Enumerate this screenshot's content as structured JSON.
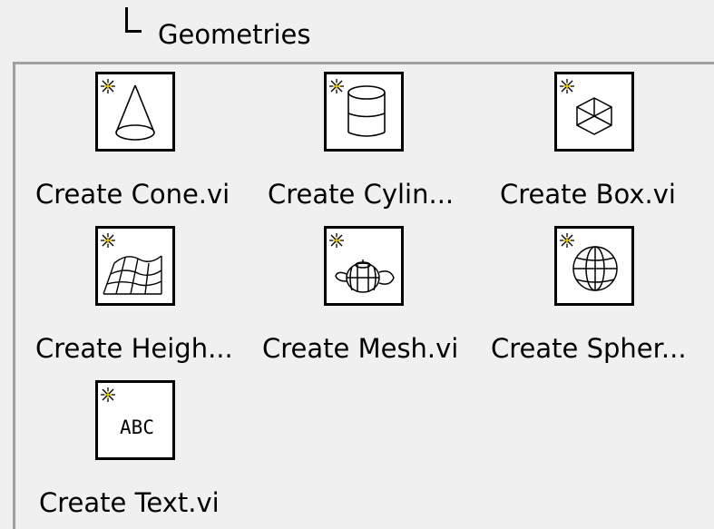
{
  "section": {
    "title": "Geometries"
  },
  "palette": {
    "items": [
      {
        "label": "Create Cone.vi",
        "icon": "cone-icon"
      },
      {
        "label": "Create Cylin...",
        "icon": "cylinder-icon"
      },
      {
        "label": "Create Box.vi",
        "icon": "box-icon"
      },
      {
        "label": "Create Heigh...",
        "icon": "heightfield-icon"
      },
      {
        "label": "Create Mesh.vi",
        "icon": "mesh-icon"
      },
      {
        "label": "Create Spher...",
        "icon": "sphere-icon"
      },
      {
        "label": "Create Text.vi",
        "icon": "text-icon"
      }
    ],
    "icon_text": "ABC",
    "accent_star_color": "#ffff00",
    "border_color": "#a0a0a0",
    "background_color": "#f0f0f0"
  }
}
